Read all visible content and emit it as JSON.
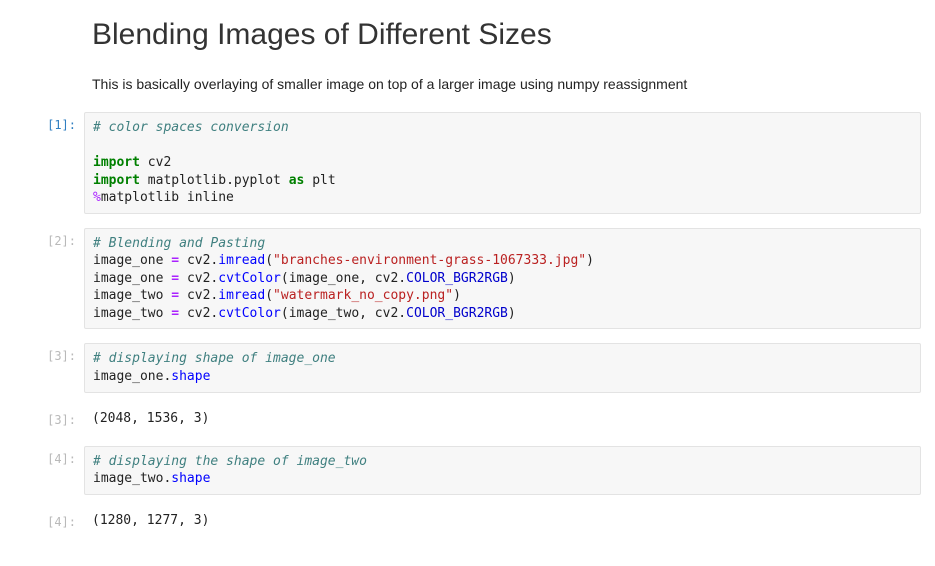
{
  "title": "Blending Images of Different Sizes",
  "description": "This is basically overlaying of smaller image on top of a larger image using numpy reassignment",
  "cells": [
    {
      "prompt": "[1]:",
      "active": true,
      "code_plain": "# color spaces conversion\n\nimport cv2\nimport matplotlib.pyplot as plt\n%matplotlib inline"
    },
    {
      "prompt": "[2]:",
      "active": false,
      "code_plain": "# Blending and Pasting\nimage_one = cv2.imread(\"branches-environment-grass-1067333.jpg\")\nimage_one = cv2.cvtColor(image_one, cv2.COLOR_BGR2RGB)\nimage_two = cv2.imread(\"watermark_no_copy.png\")\nimage_two = cv2.cvtColor(image_two, cv2.COLOR_BGR2RGB)"
    },
    {
      "prompt": "[3]:",
      "active": false,
      "code_plain": "# displaying shape of image_one\nimage_one.shape"
    },
    {
      "out_prompt": "[3]:",
      "active": false,
      "output": "(2048, 1536, 3)"
    },
    {
      "prompt": "[4]:",
      "active": false,
      "code_plain": "# displaying the shape of image_two\nimage_two.shape"
    },
    {
      "out_prompt": "[4]:",
      "active": false,
      "output": "(1280, 1277, 3)"
    }
  ],
  "code_comments": {
    "c1_l1": "# color spaces conversion",
    "c2_l1": "# Blending and Pasting",
    "c3_l1": "# displaying shape of image_one",
    "c4_l1": "# displaying the shape of image_two"
  },
  "strings": {
    "s1": "\"branches-environment-grass-1067333.jpg\"",
    "s2": "\"watermark_no_copy.png\""
  },
  "keywords": {
    "import": "import",
    "as": "as"
  },
  "idents": {
    "cv2": "cv2",
    "mpl": "matplotlib",
    "pyplot": ".pyplot ",
    "plt": "plt",
    "magic": "%",
    "mplinline": "matplotlib inline",
    "img1": "image_one",
    "img2": "image_two",
    "eq": " = ",
    "cv2dot": "cv2.",
    "imread": "imread",
    "cvtColor": "cvtColor",
    "comma": ", cv2.",
    "const": "COLOR_BGR2RGB",
    "open": "(",
    "close": ")",
    "shape1": "image_one.",
    "shape2": "image_two.",
    "shape": "shape"
  }
}
